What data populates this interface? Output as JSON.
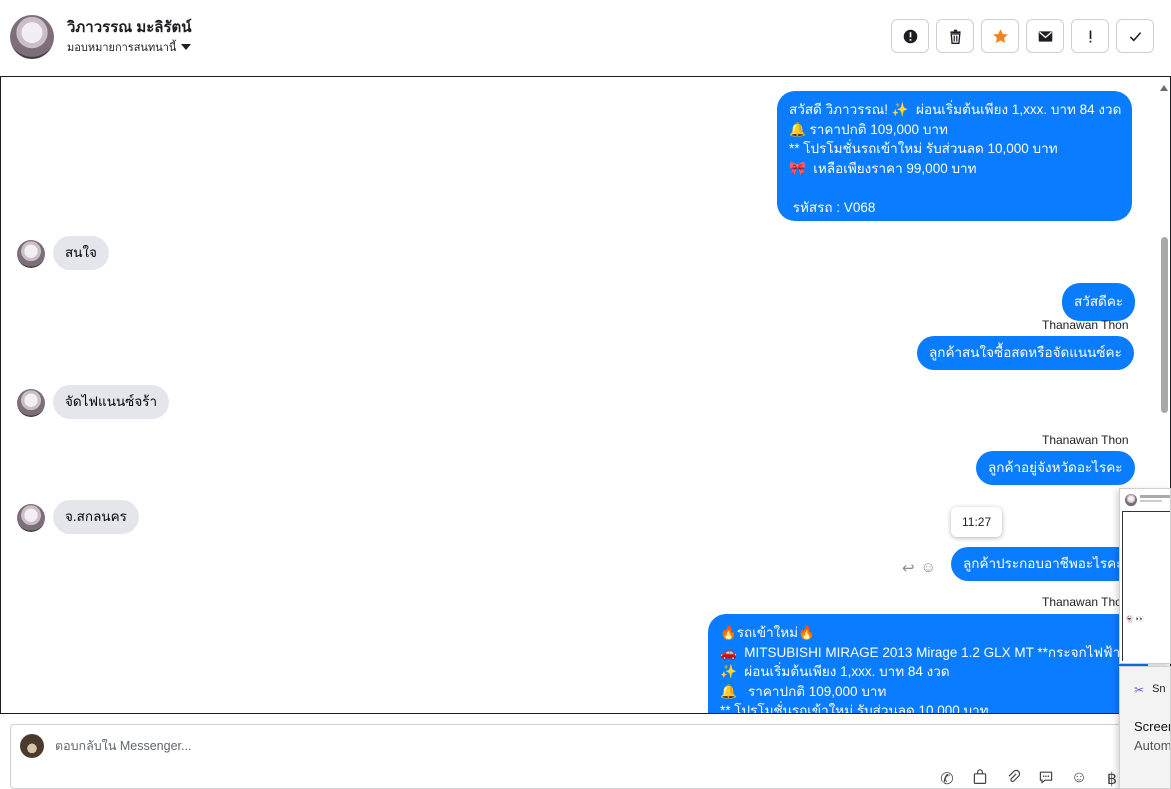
{
  "header": {
    "contact_name": "วิภาวรรณ มะลิรัตน์",
    "assign_label": "มอบหมายการสนทนานี้",
    "actions": [
      {
        "name": "report-icon",
        "glyph": "!"
      },
      {
        "name": "trash-icon",
        "glyph": ""
      },
      {
        "name": "star-icon",
        "glyph": "★"
      },
      {
        "name": "envelope-icon",
        "glyph": "✉"
      },
      {
        "name": "exclamation-icon",
        "glyph": "!"
      },
      {
        "name": "check-icon",
        "glyph": "✓"
      }
    ]
  },
  "messages": {
    "m1": "สวัสดี วิภาวรรณ! ✨  ผ่อนเริ่มต้นเพียง 1,xxx. บาท 84 งวด\n🔔 ราคาปกติ 109,000 บาท\n** โปรโมชั่นรถเข้าใหม่ รับส่วนลด 10,000 บาท\n🎀  เหลือเพียงราคา 99,000 บาท\n\n รหัสรถ : V068",
    "m2": "สนใจ",
    "m3": "สวัสดีคะ",
    "m4_sender": "Thanawan Thon",
    "m4": "ลูกค้าสนใจซื้อสดหรือจัดแนนซ์คะ",
    "m5": "จัดไฟแนนซ์จร้า",
    "m6_sender": "Thanawan Thon",
    "m6": "ลูกค้าอยู่จังหวัดอะไรคะ",
    "m7": "จ.สกลนคร",
    "tooltip_time": "11:27",
    "m8": "ลูกค้าประกอบอาชีพอะไรคะ",
    "m9_sender": "Thanawan Thon",
    "m9": "🔥รถเข้าใหม่🔥\n🚗  MITSUBISHI MIRAGE 2013 Mirage 1.2 GLX MT **กระจกไฟฟ้า\n✨  ผ่อนเริ่มต้นเพียง 1,xxx. บาท 84 งวด\n🔔   ราคาปกติ 109,000 บาท\n** โปรโมชั่นรถเข้าใหม่ รับส่วนลด 10,000 บาท"
  },
  "composer": {
    "placeholder": "ตอบกลับใน Messenger...",
    "tools": [
      "phone-plus-icon",
      "shopping-bag-icon",
      "paperclip-icon",
      "chat-bubble-icon",
      "emoji-icon",
      "baht-icon"
    ]
  },
  "snip": {
    "app_name": "Sn",
    "line1": "Screen",
    "line2": "Autom"
  },
  "colors": {
    "outgoing": "#0a7cff",
    "incoming": "#e4e6eb",
    "star": "#f5821f"
  }
}
